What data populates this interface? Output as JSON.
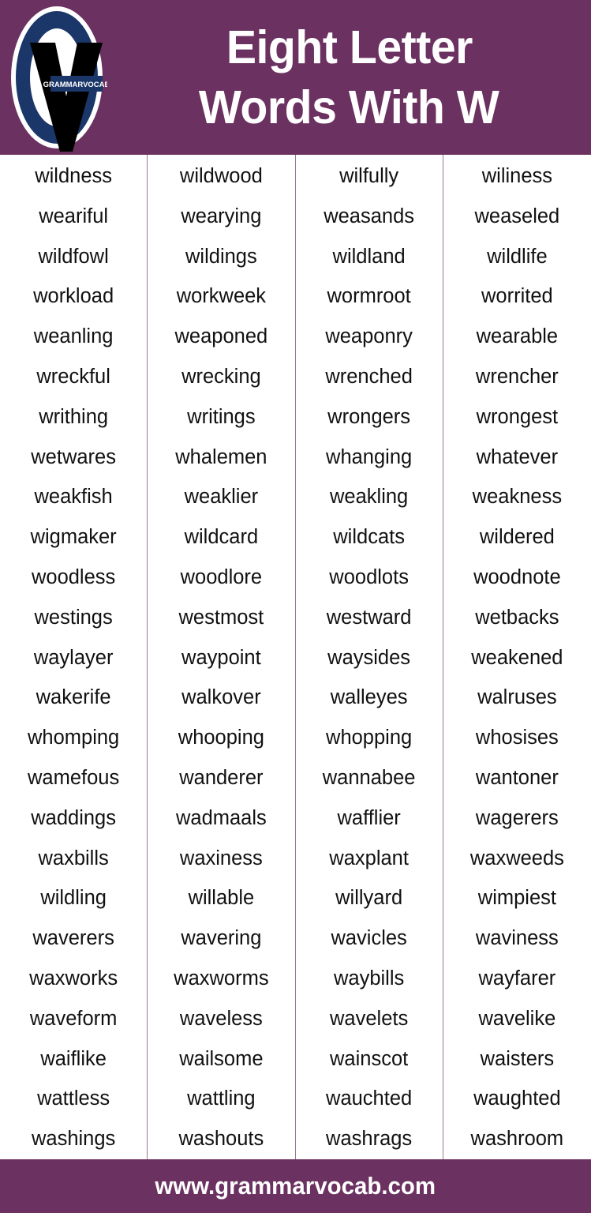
{
  "header": {
    "title_line1": "Eight Letter",
    "title_line2": "Words With W",
    "background_color": "#6B3160",
    "text_color": "#ffffff",
    "logo": {
      "brand_text": "GRAMMARVOCAB",
      "ring_color": "#1B3668",
      "letter_color": "#000000",
      "badge_color": "#1B3668"
    }
  },
  "footer": {
    "url": "www.grammarvocab.com",
    "background_color": "#6B3160",
    "text_color": "#ffffff"
  },
  "word_list": {
    "divider_color": "#9B7795",
    "columns": [
      {
        "words": [
          "wildness",
          "weariful",
          "wildfowl",
          "workload",
          "weanling",
          "wreckful",
          "writhing",
          "wetwares",
          "weakfish",
          "wigmaker",
          "woodless",
          "westings",
          "waylayer",
          "wakerife",
          "whomping",
          "wamefous",
          "waddings",
          "waxbills",
          "wildling",
          "waverers",
          "waxworks",
          "waveform",
          "waiflike",
          "wattless",
          "washings"
        ]
      },
      {
        "words": [
          "wildwood",
          "wearying",
          "wildings",
          "workweek",
          "weaponed",
          "wrecking",
          "writings",
          "whalemen",
          "weaklier",
          "wildcard",
          "woodlore",
          "westmost",
          "waypoint",
          "walkover",
          "whooping",
          "wanderer",
          "wadmaals",
          "waxiness",
          "willable",
          "wavering",
          "waxworms",
          "waveless",
          "wailsome",
          "wattling",
          "washouts"
        ]
      },
      {
        "words": [
          "wilfully",
          "weasands",
          "wildland",
          "wormroot",
          "weaponry",
          "wrenched",
          "wrongers",
          "whanging",
          "weakling",
          "wildcats",
          "woodlots",
          "westward",
          "waysides",
          "walleyes",
          "whopping",
          "wannabee",
          "wafflier",
          "waxplant",
          "willyard",
          "wavicles",
          "waybills",
          "wavelets",
          "wainscot",
          "wauchted",
          "washrags"
        ]
      },
      {
        "words": [
          "wiliness",
          "weaseled",
          "wildlife",
          "worrited",
          "wearable",
          "wrencher",
          "wrongest",
          "whatever",
          "weakness",
          "wildered",
          "woodnote",
          "wetbacks",
          "weakened",
          "walruses",
          "whosises",
          "wantoner",
          "wagerers",
          "waxweeds",
          "wimpiest",
          "waviness",
          "wayfarer",
          "wavelike",
          "waisters",
          "waughted",
          "washroom"
        ]
      }
    ]
  }
}
